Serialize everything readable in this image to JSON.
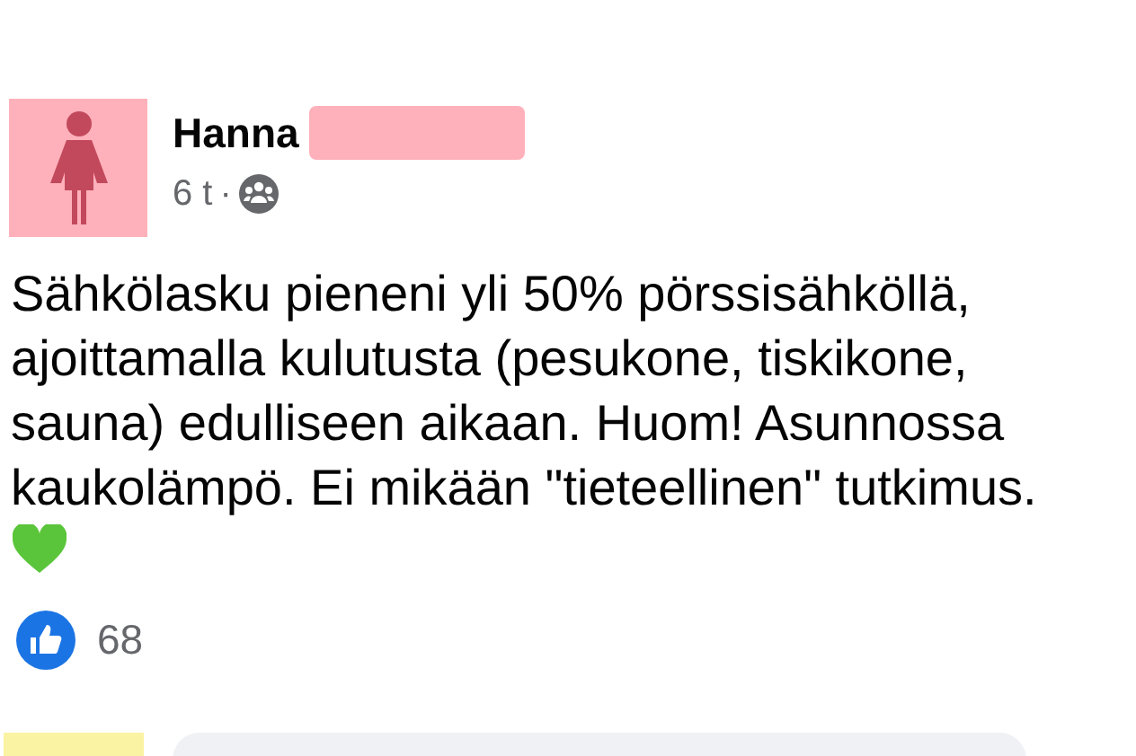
{
  "post": {
    "author": "Hanna",
    "time": "6 t",
    "separator": "·",
    "text": "Sähkölasku pieneni yli 50% pörssisähköllä, ajoittamalla kulutusta (pesukone, tiskikone, sauna) edulliseen aikaan. Huom! Asunnossa kaukolämpö. Ei mikään \"tieteellinen\" tutkimus.",
    "reactions": {
      "count": "68"
    }
  }
}
